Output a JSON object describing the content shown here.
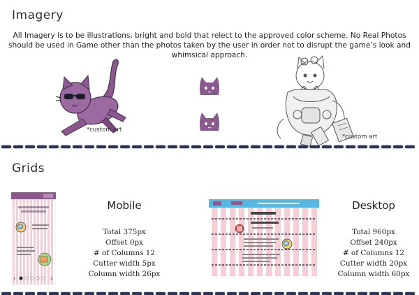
{
  "imagery": {
    "heading": "Imagery",
    "description": "All Imagery is to be illustrations, bright and bold that relect to the approved color scheme.  No Real Photos should be used in Game other than the photos taken by the user in order not to disrupt the game’s look and whimsical approach.",
    "custom_art_left": "*custom art",
    "custom_art_right": "*custom art"
  },
  "grids": {
    "heading": "Grids",
    "mobile": {
      "title": "Mobile",
      "specs": [
        "Total 375px",
        "Offset 0px",
        "# of Columns 12",
        "Cutter width 5px",
        "Column width 26px"
      ]
    },
    "desktop": {
      "title": "Desktop",
      "specs": [
        "Total 960px",
        "Offset 240px",
        "# of Columns 12",
        "Cutter width 20px",
        "Column width 60px"
      ]
    }
  },
  "colors": {
    "accent_purple": "#8a5a8e",
    "dash_navy": "#2c3553",
    "grid_pink": "#f6cfd6",
    "header_blue": "#58b7e0"
  }
}
